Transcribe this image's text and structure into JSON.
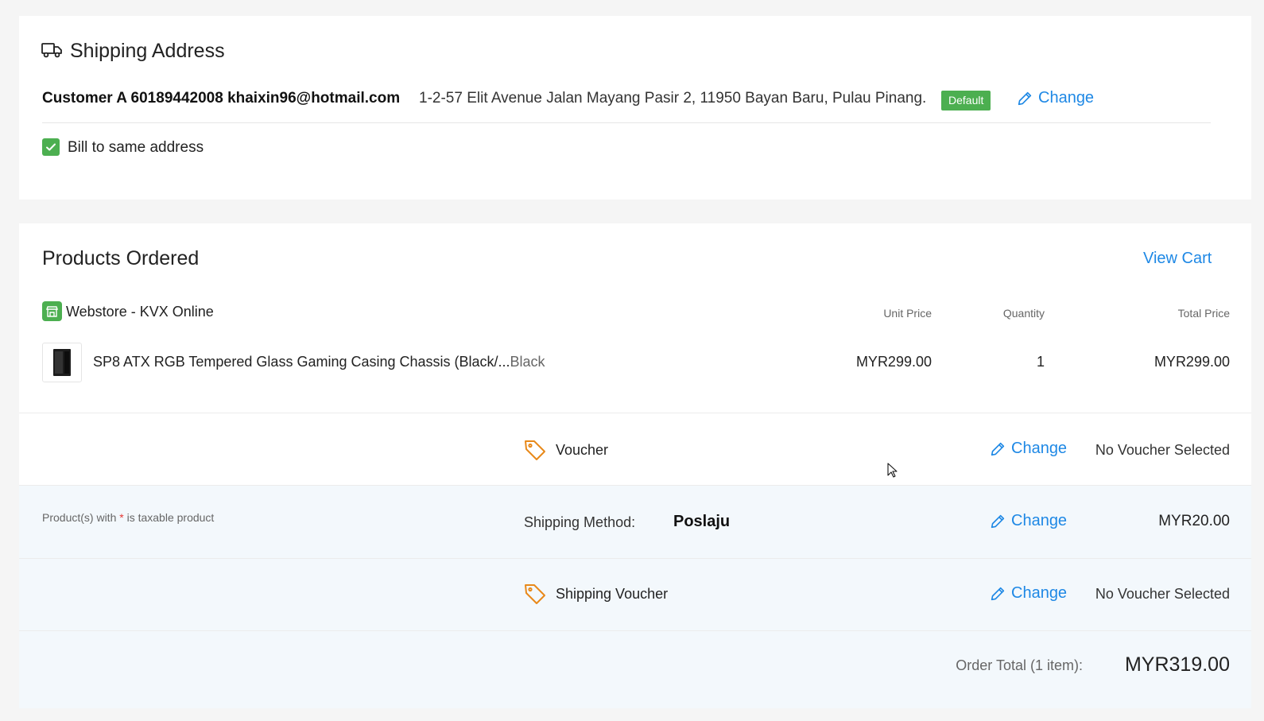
{
  "shipping": {
    "title": "Shipping Address",
    "customer": "Customer A 60189442008 khaixin96@hotmail.com",
    "address": "1-2-57 Elit Avenue Jalan Mayang Pasir 2, 11950 Bayan Baru, Pulau Pinang.",
    "default_badge": "Default",
    "change_label": "Change",
    "bill_same_label": "Bill to same address",
    "bill_same_checked": true
  },
  "products": {
    "title": "Products Ordered",
    "view_cart": "View Cart",
    "store_name": "Webstore - KVX Online",
    "columns": {
      "unit_price": "Unit Price",
      "quantity": "Quantity",
      "total_price": "Total Price"
    },
    "items": [
      {
        "name": "SP8 ATX RGB Tempered Glass Gaming Casing Chassis (Black/...",
        "variant": "Black",
        "unit_price": "MYR299.00",
        "quantity": "1",
        "total_price": "MYR299.00"
      }
    ]
  },
  "voucher": {
    "label": "Voucher",
    "change_label": "Change",
    "value": "No Voucher Selected"
  },
  "shipping_method": {
    "note_prefix": "Product(s) with ",
    "note_asterisk": "*",
    "note_suffix": " is taxable product",
    "label": "Shipping Method:",
    "value": "Poslaju",
    "change_label": "Change",
    "price": "MYR20.00"
  },
  "shipping_voucher": {
    "label": "Shipping Voucher",
    "change_label": "Change",
    "value": "No Voucher Selected"
  },
  "order_total": {
    "label": "Order Total (1 item):",
    "value": "MYR319.00"
  },
  "colors": {
    "accent": "#1e88e5",
    "success": "#4caf50",
    "voucher_icon": "#e8891a",
    "danger": "#e53935"
  },
  "icons": {
    "shipping": "truck-icon",
    "store": "store-icon",
    "voucher": "tag-icon",
    "change": "pencil-icon",
    "checkbox": "check-icon"
  }
}
